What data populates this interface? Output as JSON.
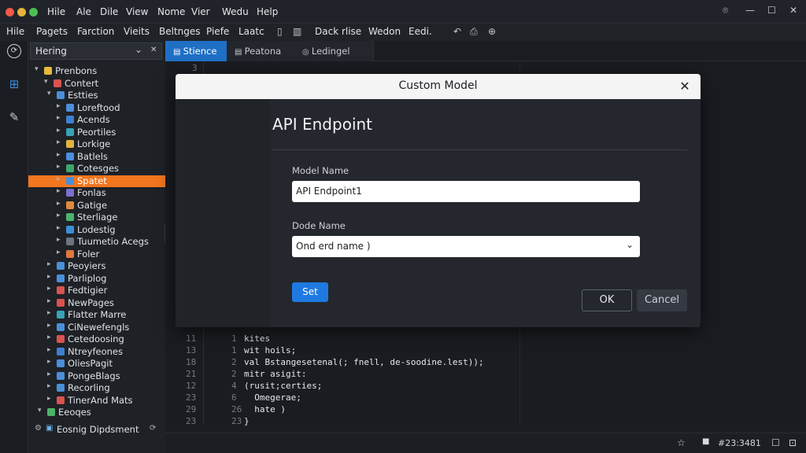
{
  "window": {
    "menu": [
      "Hile",
      "Ale",
      "Dile",
      "View",
      "Nome",
      "Vier",
      "Wedu",
      "Help"
    ],
    "controls": [
      "⌾",
      "—",
      "☐",
      "✕"
    ]
  },
  "menubar": {
    "items": [
      "Hile",
      "Pagets",
      "Farction",
      "Vieits",
      "Beltnges",
      "Piefe",
      "Laatc"
    ],
    "items_right": [
      "Dack rlise",
      "Wedon",
      "Eedi."
    ]
  },
  "sidebar": {
    "filter": {
      "value": "Hering",
      "arrow": "⌄",
      "close": "✕"
    },
    "tree": [
      {
        "label": "Prenbons",
        "color": "#e6b93d",
        "toggle": "▾"
      },
      {
        "label": "Contert",
        "color": "#d9534f",
        "toggle": "▾"
      },
      {
        "label": "Estties",
        "color": "#4a8fd9",
        "toggle": "▾"
      },
      {
        "label": "Loreftood",
        "color": "#4a8fd9",
        "toggle": "▸"
      },
      {
        "label": "Acends",
        "color": "#3d7fd1",
        "toggle": "▸"
      },
      {
        "label": "Peortiles",
        "color": "#3aa0b8",
        "toggle": "▸"
      },
      {
        "label": "Lorkige",
        "color": "#e1b33f",
        "toggle": "▸"
      },
      {
        "label": "Batlels",
        "color": "#4b8fe0",
        "toggle": "▸"
      },
      {
        "label": "Cotesges",
        "color": "#3da66b",
        "toggle": "▸"
      },
      {
        "label": "Spatet",
        "color": "#4a8fd9",
        "toggle": "▸"
      },
      {
        "label": "Fonlas",
        "color": "#7a6fd0",
        "toggle": "▸"
      },
      {
        "label": "Gatige",
        "color": "#e08a3d",
        "toggle": "▸"
      },
      {
        "label": "Sterliage",
        "color": "#4ab36a",
        "toggle": "▸"
      },
      {
        "label": "Lodestig",
        "color": "#3a8fd8",
        "toggle": "▸"
      },
      {
        "label": "Tuumetio Acegs",
        "color": "#6c7480",
        "toggle": "▸"
      },
      {
        "label": "Foler",
        "color": "#e0763d",
        "toggle": "▸"
      },
      {
        "label": "Peoyiers",
        "color": "#4a8fd9",
        "toggle": "▸"
      },
      {
        "label": "Parliplog",
        "color": "#4a8fd9",
        "toggle": "▸"
      },
      {
        "label": "Fedtigier",
        "color": "#d9534f",
        "toggle": "▸"
      },
      {
        "label": "NewPages",
        "color": "#d9534f",
        "toggle": "▸"
      },
      {
        "label": "Flatter Marre",
        "color": "#3aa0b8",
        "toggle": "▸"
      },
      {
        "label": "CiNewefengls",
        "color": "#4a8fd9",
        "toggle": "▸"
      },
      {
        "label": "Cetedoosing",
        "color": "#d9534f",
        "toggle": "▸"
      },
      {
        "label": "Ntreyfeones",
        "color": "#3d7fd1",
        "toggle": "▸"
      },
      {
        "label": "OliesPagit",
        "color": "#4a8fd9",
        "toggle": "▸"
      },
      {
        "label": "PongeBlags",
        "color": "#4a8fd9",
        "toggle": "▸"
      },
      {
        "label": "Recorling",
        "color": "#4a8fd9",
        "toggle": "▸"
      },
      {
        "label": "TinerAnd Mats",
        "color": "#d9534f",
        "toggle": "▸"
      },
      {
        "label": "Eeoqes",
        "color": "#4ab36a",
        "toggle": "▾"
      }
    ],
    "footer": "Eosnig Dipdsment",
    "selected_index": 9
  },
  "tabs": [
    {
      "label": "Stience"
    },
    {
      "label": "Peatona"
    },
    {
      "label": "Ledingel"
    }
  ],
  "editor": {
    "top_line": "3",
    "lines": [
      {
        "ln": "11",
        "ln2": "1",
        "code": "kites"
      },
      {
        "ln": "13",
        "ln2": "1",
        "code": "wit hoils;"
      },
      {
        "ln": "18",
        "ln2": "2",
        "code": "val Bstangesetenal(; fnell, de-soodine.lest));"
      },
      {
        "ln": "21",
        "ln2": "2",
        "code": "mitr asigit:"
      },
      {
        "ln": "12",
        "ln2": "4",
        "code": "(rusit;certies;"
      },
      {
        "ln": "23",
        "ln2": "6",
        "code": "  Omegerae;"
      },
      {
        "ln": "29",
        "ln2": "26",
        "code": "  hate )"
      },
      {
        "ln": "23",
        "ln2": "23",
        "code": "}"
      }
    ]
  },
  "statusbar": {
    "position": "#23:3481",
    "icons": [
      "☆",
      "■",
      "☐",
      "⊡"
    ]
  },
  "dialog": {
    "title": "Custom Model",
    "heading": "API Endpoint",
    "model_name_label": "Model Name",
    "model_name_value": "API Endpoint1",
    "node_name_label": "Dode Name",
    "node_name_value": "Ond erd name )",
    "set_label": "Set",
    "ok_label": "OK",
    "cancel_label": "Cancel"
  }
}
